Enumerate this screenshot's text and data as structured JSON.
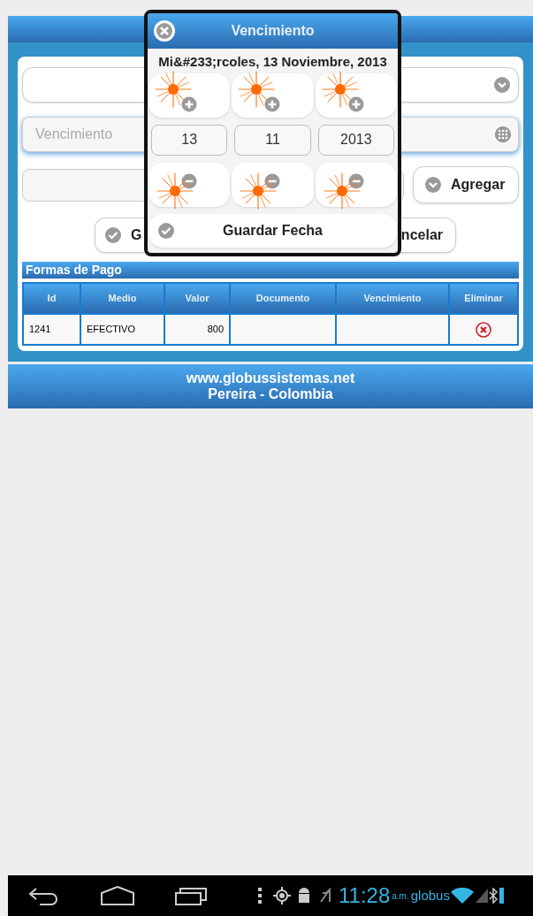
{
  "form": {
    "date_field": {
      "placeholder": "Vencimiento"
    },
    "add_button": "Agregar",
    "actions": [
      {
        "label": "G"
      },
      {
        "label": "ncelar"
      }
    ]
  },
  "payments": {
    "title": "Formas de Pago",
    "columns": [
      "Id",
      "Medio",
      "Valor",
      "Documento",
      "Vencimiento",
      "Eliminar"
    ],
    "rows": [
      {
        "id": "1241",
        "medio": "EFECTIVO",
        "valor": "800"
      }
    ]
  },
  "footer": {
    "lines": [
      "www.globussistemas.net",
      "Pereira - Colombia"
    ]
  },
  "dialog": {
    "title": "Vencimiento",
    "date_text": "Mi&#233;rcoles, 13 Noviembre, 2013",
    "parts": [
      {
        "value": "13"
      },
      {
        "value": "11"
      },
      {
        "value": "2013"
      }
    ],
    "save_button": "Guardar Fecha"
  },
  "status_bar": {
    "time": "11:28",
    "meridiem": "a.m.",
    "carrier": "globus"
  }
}
